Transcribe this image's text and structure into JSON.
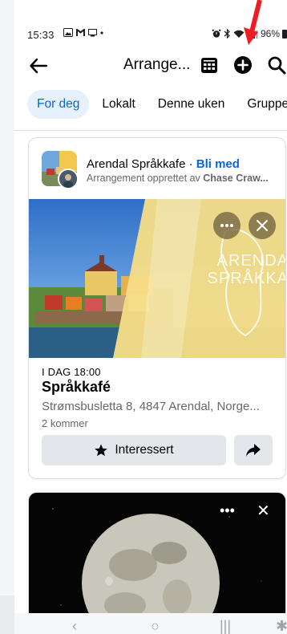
{
  "status_bar": {
    "time": "15:33",
    "battery": "96%"
  },
  "header": {
    "title": "Arrange...",
    "icons": [
      "back-arrow-icon",
      "calendar-icon",
      "plus-circle-icon",
      "search-icon"
    ]
  },
  "tabs": [
    {
      "label": "For deg",
      "active": true
    },
    {
      "label": "Lokalt",
      "active": false
    },
    {
      "label": "Denne uken",
      "active": false
    },
    {
      "label": "Grupper",
      "active": false
    }
  ],
  "event_card": {
    "page_name": "Arendal Språkkafe",
    "separator": " · ",
    "join_label": "Bli med",
    "created_by_prefix": "Arrangement opprettet av",
    "created_by_name": "Chase Craw...",
    "image_watermark_1": "ARENDA",
    "image_watermark_2": "SPRÅKKA",
    "date": "I DAG 18:00",
    "title": "Språkkafé",
    "address": "Strømsbusletta 8, 4847 Arendal, Norge...",
    "attendees": "2 kommer",
    "interested_label": "Interessert",
    "colors": {
      "accent": "#0a66d8",
      "button_bg": "#e4e6eb"
    }
  },
  "second_card": {
    "image": "full-moon"
  },
  "annotation": {
    "color": "#ee1c24"
  }
}
